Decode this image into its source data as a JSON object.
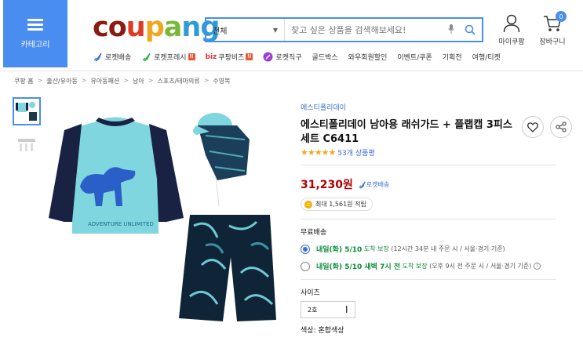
{
  "header": {
    "category_label": "카테고리",
    "logo_letters": [
      "c",
      "o",
      "u",
      "p",
      "a",
      "n",
      "g"
    ],
    "search": {
      "category": "전체",
      "placeholder": "찾고 싶은 상품을 검색해보세요!"
    },
    "mypage_label": "마이쿠팡",
    "cart_label": "장바구니",
    "cart_count": "0"
  },
  "nav": {
    "items": [
      {
        "label": "로켓배송",
        "icon": "rocket-icon"
      },
      {
        "label": "로켓프레시",
        "icon": "rocket-fresh-icon",
        "badge": "N"
      },
      {
        "label": "쿠팡비즈",
        "prefix": "biz",
        "badge": "N"
      },
      {
        "label": "로켓직구",
        "icon": "rocket-global-icon"
      },
      {
        "label": "골드박스"
      },
      {
        "label": "와우회원할인"
      },
      {
        "label": "이벤트/쿠폰"
      },
      {
        "label": "기획전"
      },
      {
        "label": "여행/티켓"
      }
    ]
  },
  "breadcrumb": [
    "쿠팡 홈",
    "출산/유아동",
    "유아동패션",
    "남아",
    "스포츠/테마의류",
    "수영복"
  ],
  "product": {
    "brand": "에스티폴리데이",
    "title": "에스티폴리데이 남아용 래쉬가드 + 플랩캡 3피스 세트 C6411",
    "stars": "★★★★★",
    "review_count": "53개 상품평",
    "price": "31,230원",
    "rocket_tag": "로켓배송",
    "points_label": "최대 1,561원 적립",
    "coin": "c",
    "shipping_label": "무료배송",
    "shipping_options": [
      {
        "date": "내일(화) 5/10",
        "suffix": "도착 보장",
        "note": "(12시간 34분 내 주문 시 / 서울·경기 기준)",
        "selected": true
      },
      {
        "date": "내일(화) 5/10 새벽 7시 전",
        "suffix": "도착 보장",
        "note": "(오후 9시 전 주문 시 / 서울·경기 기준)",
        "selected": false
      }
    ],
    "size_label": "사이즈",
    "size_value": "2호",
    "color_label": "색상: 혼합색상",
    "graphic_text": "ADVENTURE UNLIMITED"
  },
  "colors": {
    "accent": "#4a8df0",
    "price": "#ae0000",
    "delivery_green": "#0a8c3a"
  }
}
